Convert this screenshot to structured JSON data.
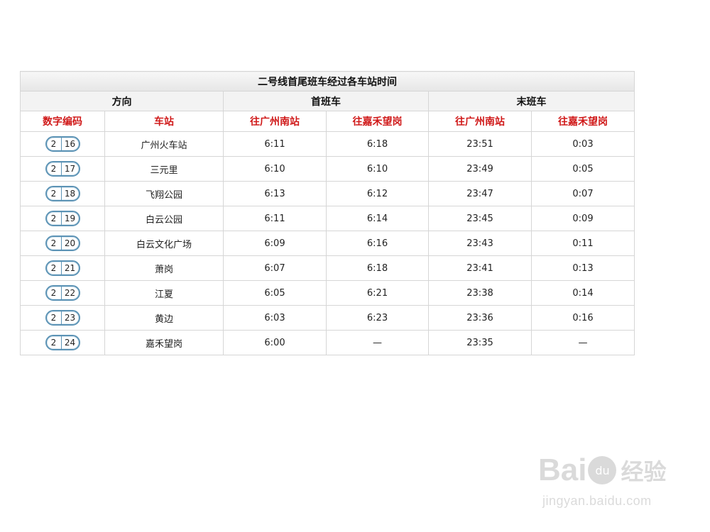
{
  "table": {
    "title": "二号线首尾班车经过各车站时间",
    "groups": {
      "direction": "方向",
      "first_train": "首班车",
      "last_train": "末班车"
    },
    "subheaders": {
      "code": "数字编码",
      "station": "车站",
      "first_to_guangzhou_south": "往广州南站",
      "first_to_jiahewanggang": "往嘉禾望岗",
      "last_to_guangzhou_south": "往广州南站",
      "last_to_jiahewanggang": "往嘉禾望岗"
    },
    "rows": [
      {
        "line": "2",
        "code": "16",
        "station": "广州火车站",
        "first_south": "6:11",
        "first_north": "6:18",
        "last_south": "23:51",
        "last_north": "0:03"
      },
      {
        "line": "2",
        "code": "17",
        "station": "三元里",
        "first_south": "6:10",
        "first_north": "6:10",
        "last_south": "23:49",
        "last_north": "0:05"
      },
      {
        "line": "2",
        "code": "18",
        "station": "飞翔公园",
        "first_south": "6:13",
        "first_north": "6:12",
        "last_south": "23:47",
        "last_north": "0:07"
      },
      {
        "line": "2",
        "code": "19",
        "station": "白云公园",
        "first_south": "6:11",
        "first_north": "6:14",
        "last_south": "23:45",
        "last_north": "0:09"
      },
      {
        "line": "2",
        "code": "20",
        "station": "白云文化广场",
        "first_south": "6:09",
        "first_north": "6:16",
        "last_south": "23:43",
        "last_north": "0:11"
      },
      {
        "line": "2",
        "code": "21",
        "station": "萧岗",
        "first_south": "6:07",
        "first_north": "6:18",
        "last_south": "23:41",
        "last_north": "0:13"
      },
      {
        "line": "2",
        "code": "22",
        "station": "江夏",
        "first_south": "6:05",
        "first_north": "6:21",
        "last_south": "23:38",
        "last_north": "0:14"
      },
      {
        "line": "2",
        "code": "23",
        "station": "黄边",
        "first_south": "6:03",
        "first_north": "6:23",
        "last_south": "23:36",
        "last_north": "0:16"
      },
      {
        "line": "2",
        "code": "24",
        "station": "嘉禾望岗",
        "first_south": "6:00",
        "first_north": "—",
        "last_south": "23:35",
        "last_north": "—"
      }
    ]
  },
  "watermark": {
    "logo_text": "Baidu经验",
    "url": "jingyan.baidu.com"
  },
  "colors": {
    "header_red": "#d01a1a",
    "badge_blue": "#5c93b5",
    "border_gray": "#d6d6d6"
  }
}
